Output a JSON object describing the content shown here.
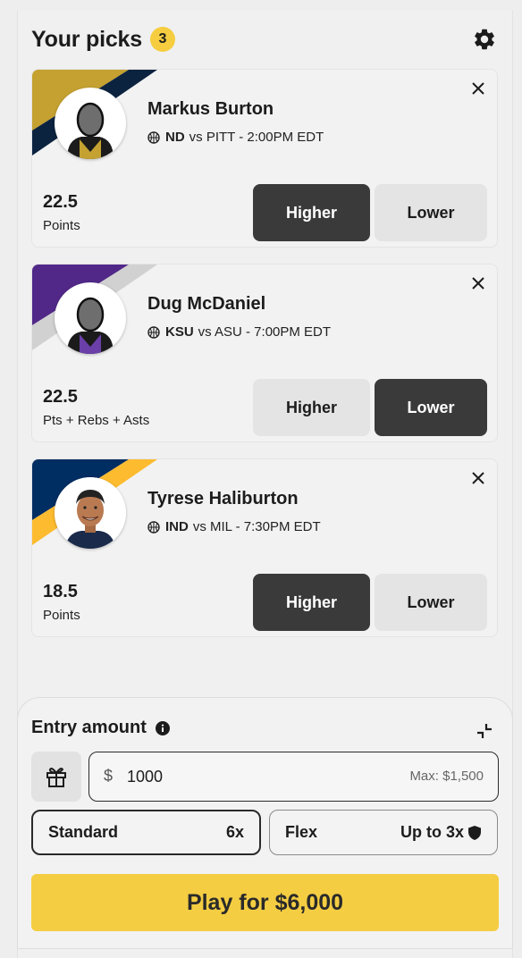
{
  "header": {
    "title": "Your picks",
    "count": "3"
  },
  "picks": [
    {
      "player": "Markus Burton",
      "team": "ND",
      "matchup_rest": "vs PITT - 2:00PM EDT",
      "line": "22.5",
      "stat": "Points",
      "higher_label": "Higher",
      "lower_label": "Lower",
      "selected": "higher",
      "colors": {
        "primary": "#c4a131",
        "secondary": "#0c2340",
        "jersey": "#c4a131"
      }
    },
    {
      "player": "Dug McDaniel",
      "team": "KSU",
      "matchup_rest": "vs ASU - 7:00PM EDT",
      "line": "22.5",
      "stat": "Pts + Rebs + Asts",
      "higher_label": "Higher",
      "lower_label": "Lower",
      "selected": "lower",
      "colors": {
        "primary": "#512888",
        "secondary": "#d1d1d1",
        "jersey": "#512888"
      }
    },
    {
      "player": "Tyrese Haliburton",
      "team": "IND",
      "matchup_rest": "vs MIL - 7:30PM EDT",
      "line": "18.5",
      "stat": "Points",
      "higher_label": "Higher",
      "lower_label": "Lower",
      "selected": "higher",
      "colors": {
        "primary": "#002d62",
        "secondary": "#fdbb30",
        "jersey": "#002d62"
      }
    }
  ],
  "entry": {
    "label": "Entry amount",
    "currency_symbol": "$",
    "amount": "1000",
    "max_label": "Max: $1,500",
    "modes": [
      {
        "name": "Standard",
        "multiplier": "6x",
        "selected": true
      },
      {
        "name": "Flex",
        "multiplier": "Up to 3x",
        "selected": false
      }
    ],
    "play_label": "Play for $6,000"
  },
  "icons": [
    "gear-icon",
    "close-icon",
    "basketball-icon",
    "info-icon",
    "collapse-icon",
    "gift-icon",
    "shield-icon"
  ],
  "accent_color": "#f4cd42"
}
